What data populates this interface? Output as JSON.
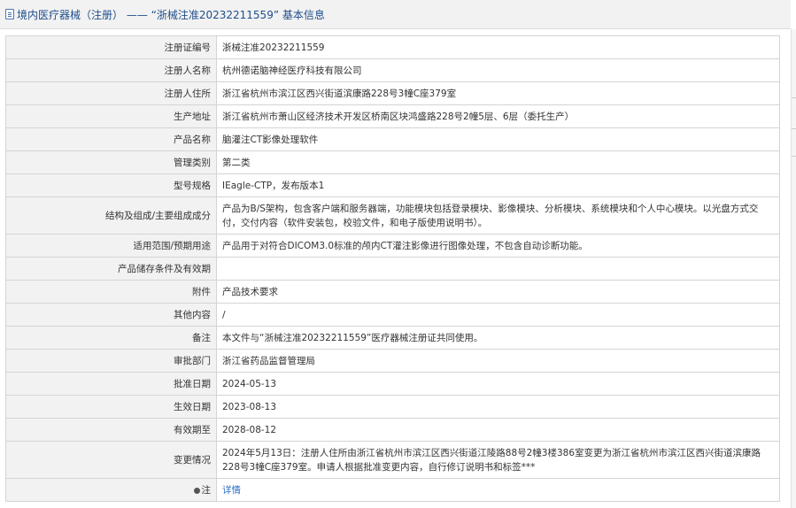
{
  "header": {
    "title": "境内医疗器械（注册） —— “浙械注准20232211559” 基本信息"
  },
  "rows": [
    {
      "label": "注册证编号",
      "value": "浙械注准20232211559"
    },
    {
      "label": "注册人名称",
      "value": "杭州德诺脑神经医疗科技有限公司"
    },
    {
      "label": "注册人住所",
      "value": "浙江省杭州市滨江区西兴街道滨康路228号3幢C座379室"
    },
    {
      "label": "生产地址",
      "value": "浙江省杭州市萧山区经济技术开发区桥南区块鸿盛路228号2幢5层、6层（委托生产）"
    },
    {
      "label": "产品名称",
      "value": "脑灌注CT影像处理软件"
    },
    {
      "label": "管理类别",
      "value": "第二类"
    },
    {
      "label": "型号规格",
      "value": "IEagle-CTP，发布版本1"
    },
    {
      "label": "结构及组成/主要组成成分",
      "value": "产品为B/S架构，包含客户端和服务器端，功能模块包括登录模块、影像模块、分析模块、系统模块和个人中心模块。以光盘方式交付，交付内容（软件安装包，校验文件，和电子版使用说明书）。"
    },
    {
      "label": "适用范围/预期用途",
      "value": "产品用于对符合DICOM3.0标准的颅内CT灌注影像进行图像处理，不包含自动诊断功能。"
    },
    {
      "label": "产品储存条件及有效期",
      "value": ""
    },
    {
      "label": "附件",
      "value": "产品技术要求"
    },
    {
      "label": "其他内容",
      "value": "/"
    },
    {
      "label": "备注",
      "value": "本文件与“浙械注准20232211559”医疗器械注册证共同使用。"
    },
    {
      "label": "审批部门",
      "value": "浙江省药品监督管理局"
    },
    {
      "label": "批准日期",
      "value": "2024-05-13"
    },
    {
      "label": "生效日期",
      "value": "2023-08-13"
    },
    {
      "label": "有效期至",
      "value": "2028-08-12"
    },
    {
      "label": "变更情况",
      "value": "2024年5月13日：注册人住所由浙江省杭州市滨江区西兴街道江陵路88号2幢3楼386室变更为浙江省杭州市滨江区西兴街道滨康路228号3幢C座379室。申请人根据批准变更内容，自行修订说明书和标签***"
    }
  ],
  "note": {
    "label": "注",
    "icon": "note-icon",
    "link_text": "详情"
  }
}
